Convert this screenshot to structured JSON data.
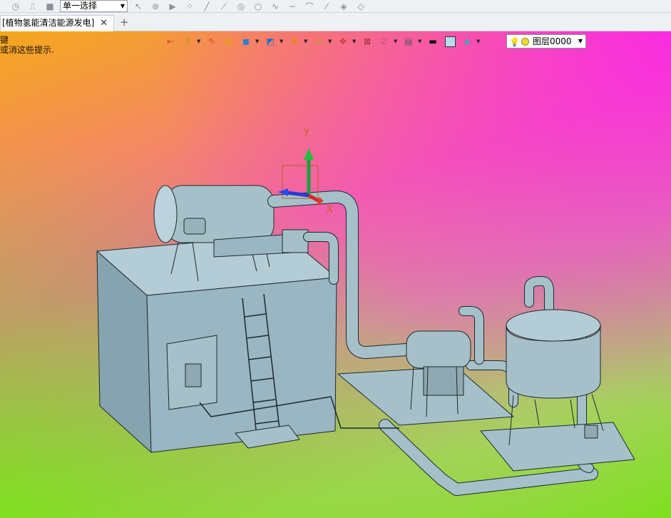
{
  "toolbar": {
    "selection_mode": "单一选择",
    "icons": [
      "history-icon",
      "undo-step-icon",
      "stop-icon",
      "pointer-icon",
      "pick-filter-icon",
      "play-icon",
      "point-icon",
      "line-icon",
      "line-icon",
      "circle-icon",
      "circle-icon",
      "spline-icon",
      "arc-icon",
      "arc-icon",
      "line-icon",
      "surface-icon",
      "surface-icon"
    ]
  },
  "tabs": [
    {
      "label": "[植物氢能清洁能源发电]",
      "close": "✕"
    }
  ],
  "viewport": {
    "hint_line1": "键",
    "hint_line2": "或消这些提示.",
    "axis_y": "Y",
    "axis_x": "X",
    "layer": {
      "label": "图层0000"
    }
  },
  "colors": {
    "model": "#9cb8c4",
    "model_dark": "#6f8d99",
    "edge": "#1b2a30"
  }
}
